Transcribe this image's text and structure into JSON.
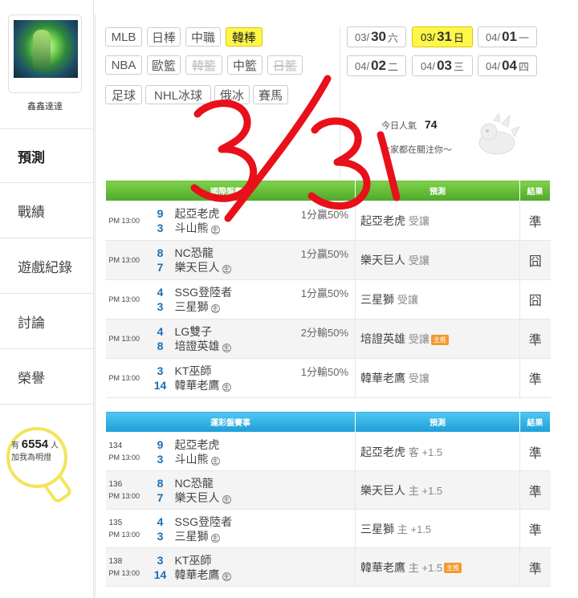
{
  "profile": {
    "username": "鑫鑫達達"
  },
  "menu": [
    {
      "label": "預測",
      "active": true
    },
    {
      "label": "戰績",
      "active": false
    },
    {
      "label": "遊戲紀錄",
      "active": false
    },
    {
      "label": "討論",
      "active": false
    },
    {
      "label": "榮譽",
      "active": false
    }
  ],
  "fans": {
    "prefix": "有",
    "count": "6554",
    "suffix": "人",
    "line2": "加我為明燈"
  },
  "sport_tabs": [
    {
      "label": "MLB",
      "state": "normal"
    },
    {
      "label": "日棒",
      "state": "normal"
    },
    {
      "label": "中職",
      "state": "normal"
    },
    {
      "label": "韓棒",
      "state": "active"
    },
    {
      "label": "NBA",
      "state": "normal"
    },
    {
      "label": "歐籃",
      "state": "normal"
    },
    {
      "label": "韓籃",
      "state": "disabled"
    },
    {
      "label": "中籃",
      "state": "normal"
    },
    {
      "label": "日籃",
      "state": "disabled"
    },
    {
      "label": "足球",
      "state": "normal"
    },
    {
      "label": "NHL冰球",
      "state": "normal"
    },
    {
      "label": "俄冰",
      "state": "normal"
    },
    {
      "label": "賽馬",
      "state": "normal"
    }
  ],
  "date_tabs": [
    {
      "month": "03/",
      "day": "30",
      "weekday": "六",
      "active": false
    },
    {
      "month": "03/",
      "day": "31",
      "weekday": "日",
      "active": true
    },
    {
      "month": "04/",
      "day": "01",
      "weekday": "一",
      "active": false
    },
    {
      "month": "04/",
      "day": "02",
      "weekday": "二",
      "active": false
    },
    {
      "month": "04/",
      "day": "03",
      "weekday": "三",
      "active": false
    },
    {
      "month": "04/",
      "day": "04",
      "weekday": "四",
      "active": false
    }
  ],
  "stats": {
    "popularity_label": "今日人氣",
    "popularity_value": "74",
    "follow_text": "大家都在關注你～"
  },
  "intl_table": {
    "headers": {
      "game": "國際盤賽事",
      "pick": "預測",
      "result": "結果"
    },
    "rows": [
      {
        "time": "PM 13:00",
        "away_score": "9",
        "home_score": "3",
        "away": "起亞老虎",
        "home": "斗山熊",
        "home_mark": "主",
        "odds": "1分贏50%",
        "pick": "起亞老虎",
        "pick_sub": "受讓",
        "badge": "",
        "result": "準",
        "ok": true
      },
      {
        "time": "PM 13:00",
        "away_score": "8",
        "home_score": "7",
        "away": "NC恐龍",
        "home": "樂天巨人",
        "home_mark": "主",
        "odds": "1分贏50%",
        "pick": "樂天巨人",
        "pick_sub": "受讓",
        "badge": "",
        "result": "囧",
        "ok": false
      },
      {
        "time": "PM 13:00",
        "away_score": "4",
        "home_score": "3",
        "away": "SSG登陸者",
        "home": "三星獅",
        "home_mark": "主",
        "odds": "1分贏50%",
        "pick": "三星獅",
        "pick_sub": "受讓",
        "badge": "",
        "result": "囧",
        "ok": false
      },
      {
        "time": "PM 13:00",
        "away_score": "4",
        "home_score": "8",
        "away": "LG雙子",
        "home": "培證英雄",
        "home_mark": "主",
        "odds": "2分輸50%",
        "pick": "培證英雄",
        "pick_sub": "受讓",
        "badge": "主推",
        "result": "準",
        "ok": true
      },
      {
        "time": "PM 13:00",
        "away_score": "3",
        "home_score": "14",
        "away": "KT巫師",
        "home": "韓華老鷹",
        "home_mark": "主",
        "odds": "1分輸50%",
        "pick": "韓華老鷹",
        "pick_sub": "受讓",
        "badge": "",
        "result": "準",
        "ok": true
      }
    ]
  },
  "lottery_table": {
    "headers": {
      "game": "運彩盤賽事",
      "pick": "預測",
      "result": "結果"
    },
    "rows": [
      {
        "no": "134",
        "time": "PM 13:00",
        "away_score": "9",
        "home_score": "3",
        "away": "起亞老虎",
        "home": "斗山熊",
        "home_mark": "主",
        "pick": "起亞老虎",
        "pick_sub": "客 +1.5",
        "badge": "",
        "result": "準",
        "ok": true
      },
      {
        "no": "136",
        "time": "PM 13:00",
        "away_score": "8",
        "home_score": "7",
        "away": "NC恐龍",
        "home": "樂天巨人",
        "home_mark": "主",
        "pick": "樂天巨人",
        "pick_sub": "主 +1.5",
        "badge": "",
        "result": "準",
        "ok": true
      },
      {
        "no": "135",
        "time": "PM 13:00",
        "away_score": "4",
        "home_score": "3",
        "away": "SSG登陸者",
        "home": "三星獅",
        "home_mark": "主",
        "pick": "三星獅",
        "pick_sub": "主 +1.5",
        "badge": "",
        "result": "準",
        "ok": true
      },
      {
        "no": "138",
        "time": "PM 13:00",
        "away_score": "3",
        "home_score": "14",
        "away": "KT巫師",
        "home": "韓華老鷹",
        "home_mark": "主",
        "pick": "韓華老鷹",
        "pick_sub": "主 +1.5",
        "badge": "主推",
        "result": "準",
        "ok": true
      }
    ]
  },
  "annotation": {
    "text": "3/31",
    "color": "#e8101a"
  }
}
